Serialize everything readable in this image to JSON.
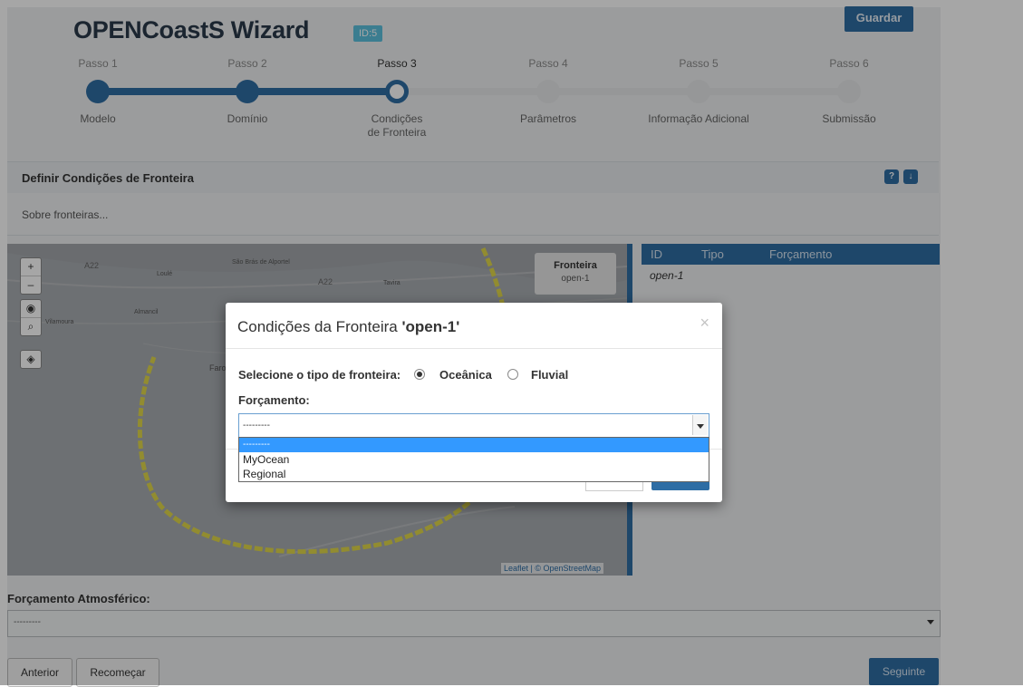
{
  "header": {
    "title": "OPENCoastS Wizard",
    "id_badge": "ID:5",
    "save_label": "Guardar"
  },
  "steps": [
    {
      "label": "Passo 1",
      "name": "Modelo",
      "state": "done"
    },
    {
      "label": "Passo 2",
      "name": "Domínio",
      "state": "done"
    },
    {
      "label": "Passo 3",
      "name_line1": "Condições",
      "name_line2": "de Fronteira",
      "state": "current"
    },
    {
      "label": "Passo 4",
      "name": "Parâmetros",
      "state": "pending"
    },
    {
      "label": "Passo 5",
      "name": "Informação Adicional",
      "state": "pending"
    },
    {
      "label": "Passo 6",
      "name": "Submissão",
      "state": "pending"
    }
  ],
  "panel": {
    "title": "Definir Condições de Fronteira",
    "about": "Sobre fronteiras..."
  },
  "map": {
    "zoom_in": "+",
    "zoom_out": "–",
    "boundary_box_title": "Fronteira",
    "boundary_box_name": "open-1",
    "attribution": "Leaflet | © OpenStreetMap",
    "place_labels": [
      "São Brás de Alportel",
      "Loulé",
      "Tavira",
      "Almancil",
      "Vilamoura",
      "Faro"
    ],
    "road_labels": [
      "A22",
      "A22",
      "A22"
    ]
  },
  "table": {
    "headers": [
      "ID",
      "Tipo",
      "Forçamento"
    ],
    "rows": [
      [
        "open-1",
        "",
        ""
      ]
    ]
  },
  "atmospheric": {
    "label": "Forçamento Atmosférico:",
    "value": "---------"
  },
  "buttons": {
    "previous": "Anterior",
    "restart": "Recomeçar",
    "next": "Seguinte"
  },
  "modal": {
    "title_prefix": "Condições da Fronteira ",
    "title_name": "'open-1'",
    "close": "×",
    "type_label": "Selecione o tipo de fronteira:",
    "option_ocean": "Oceânica",
    "option_river": "Fluvial",
    "selected_type": "Oceânica",
    "forcing_label": "Forçamento:",
    "forcing_value": "---------",
    "forcing_options": [
      "---------",
      "MyOcean",
      "Regional"
    ]
  },
  "colors": {
    "primary": "#2e6da4",
    "boundary_line": "#e0d84a",
    "badge": "#5bc0de"
  }
}
